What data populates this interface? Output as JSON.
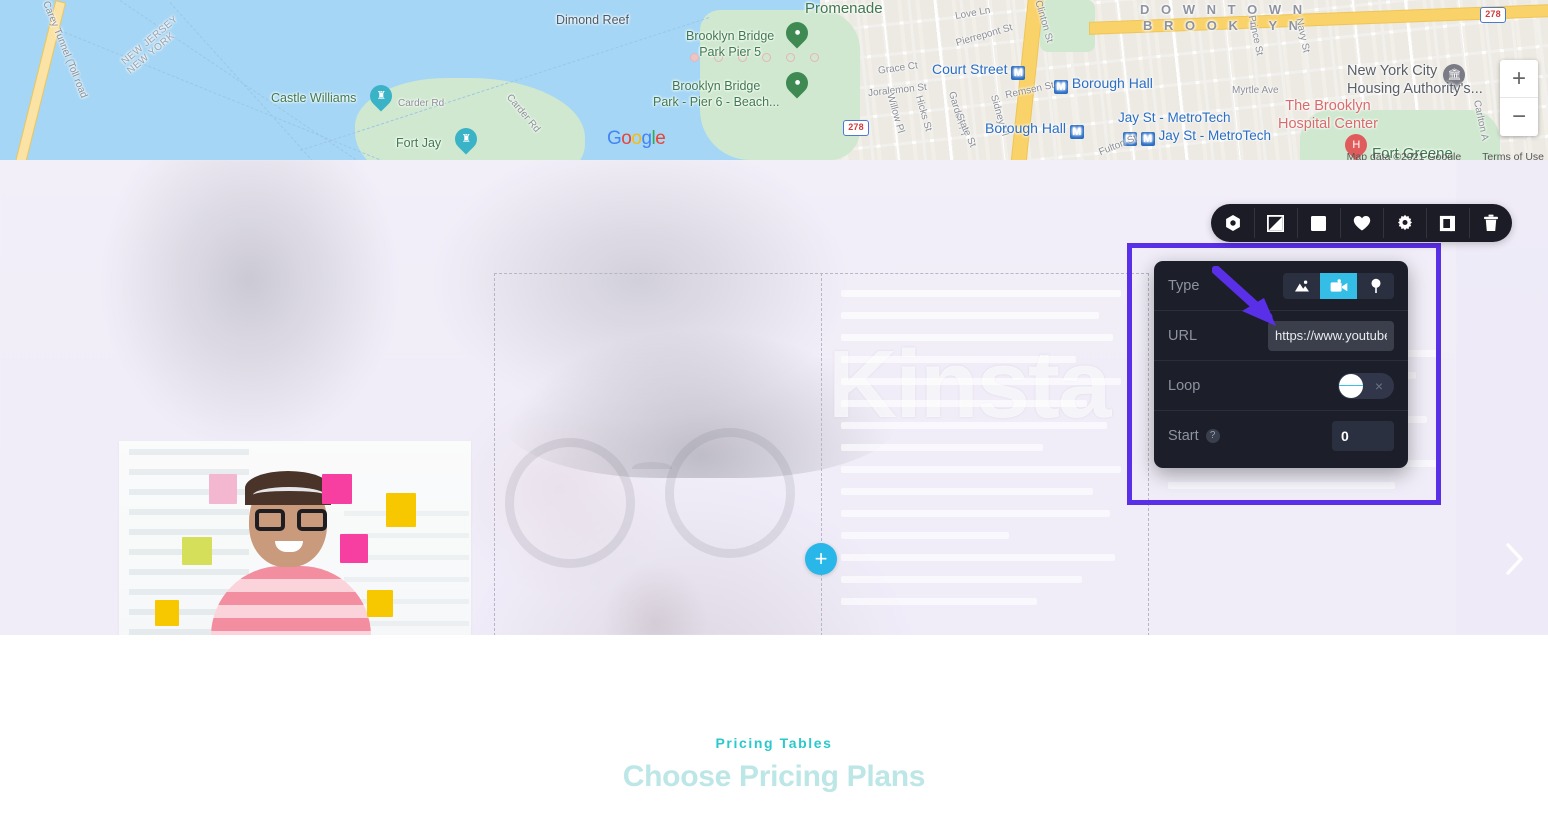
{
  "map": {
    "attribution": "Map data ©2021 Google",
    "terms": "Terms of Use",
    "zoom_in": "+",
    "zoom_out": "−",
    "google_logo": {
      "g1": "G",
      "o1": "o",
      "o2": "o",
      "g2": "g",
      "l": "l",
      "e": "e"
    },
    "labels": {
      "new_jersey": "NEW JERSEY",
      "new_york": "NEW YORK",
      "castle_williams": "Castle Williams",
      "fort_jay": "Fort Jay",
      "carder_rd": "Carder Rd",
      "carder_rd2": "Carder Rd",
      "dimond_reef": "Dimond Reef",
      "carey_tunnel": "ugh L. Carey Tunnel (Toll road",
      "bb_pier5": "Brooklyn Bridge\nPark Pier 5",
      "bb_pier6": "Brooklyn Bridge\nPark - Pier 6 - Beach...",
      "promenade": "Promenade",
      "love_ln": "Love Ln",
      "pierrepont_st": "Pierrepont St",
      "clinton_st": "Clinton St",
      "court_street": "Court Street",
      "grace_ct": "Grace Ct",
      "joralemon_st": "Joralemon St",
      "remsen_st": "Remsen St",
      "willow_pl": "Willow Pl",
      "hicks_st": "Hicks St",
      "garden_pl": "Garden Pl",
      "sidney_pl": "Sidney Pl",
      "state_st": "State St",
      "borough_hall": "Borough Hall",
      "borough_hall2": "Borough Hall",
      "jay_st_1": "Jay St - MetroTech",
      "jay_st_2": "Jay St - MetroTech",
      "fulton_st": "Fulton St",
      "downtown": "D O W N T O W N",
      "brooklyn": "B R O O K L Y N",
      "prince_st": "Prince St",
      "navy_st": "Navy St",
      "myrtle_ave": "Myrtle Ave",
      "nycha": "New York City\nHousing Authority's...",
      "brooklyn_hospital": "The Brooklyn\nHospital Center",
      "fort_greene": "Fort Greene",
      "carlton_a": "Carlton A",
      "hwy_278": "278",
      "hwy_278b": "278",
      "metro_m": "M"
    }
  },
  "hero": {
    "watermark": "Kinsta",
    "add_button_label": "+",
    "next_slide_label": "chevron-right"
  },
  "toolbar": {
    "items": [
      {
        "name": "settings-hex-icon",
        "label": "Element settings"
      },
      {
        "name": "shape-diagonal-icon",
        "label": "Shape"
      },
      {
        "name": "square-icon",
        "label": "Background"
      },
      {
        "name": "heart-icon",
        "label": "Favorite"
      },
      {
        "name": "gear-icon",
        "label": "Options"
      },
      {
        "name": "duplicate-icon",
        "label": "Duplicate"
      },
      {
        "name": "trash-icon",
        "label": "Delete"
      }
    ]
  },
  "settings_panel": {
    "rows": {
      "type": {
        "label": "Type",
        "options": [
          {
            "name": "image-type",
            "icon": "image-icon",
            "active": false
          },
          {
            "name": "video-type",
            "icon": "video-camera-icon",
            "active": true
          },
          {
            "name": "map-type",
            "icon": "map-pin-icon",
            "active": false
          }
        ]
      },
      "url": {
        "label": "URL",
        "value": "https://www.youtube",
        "placeholder": "https://"
      },
      "loop": {
        "label": "Loop",
        "state": "off",
        "off_label": "×"
      },
      "start": {
        "label": "Start",
        "help": "?",
        "value": "0"
      }
    }
  },
  "pricing": {
    "eyebrow": "Pricing Tables",
    "title": "Choose Pricing Plans"
  },
  "colors": {
    "accent_cyan": "#34bde5",
    "annotation_purple": "#5a2fe8",
    "panel_bg": "#1c1f29",
    "toolbar_bg": "#1c1c27",
    "pricing_eyebrow": "#2cc8cb",
    "pricing_title": "#bde6e6"
  }
}
